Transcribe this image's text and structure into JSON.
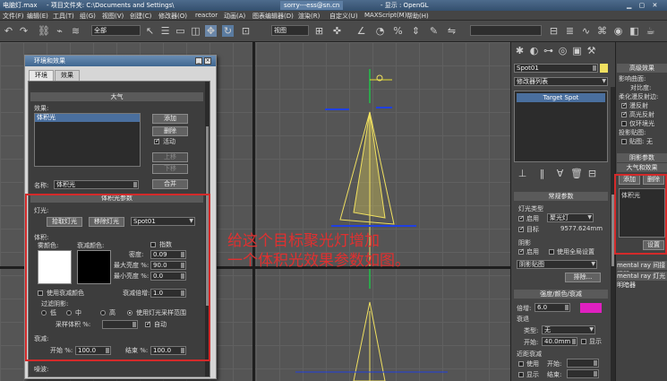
{
  "titlebar": {
    "file": "电脑灯.max",
    "project": "- 项目文件夹: C:\\Documents and Settings\\",
    "tab": "sorry---ess@sn.cn",
    "product": "- 显示 : OpenGL"
  },
  "menu": [
    "文件(F)",
    "编辑(E)",
    "工具(T)",
    "组(G)",
    "视图(V)",
    "创建(C)",
    "修改器(O)",
    "reactor",
    "动画(A)",
    "图表编辑器(D)",
    "渲染(R)",
    "自定义(U)",
    "MAXScript(M)",
    "帮助(H)"
  ],
  "toolbar": {
    "selection_filter": "全部",
    "coord_system": "视图",
    "named_selection": ""
  },
  "dialog": {
    "title": "环境和效果",
    "tabs": [
      "环境",
      "效果"
    ],
    "atmosphere": {
      "rollout": "大气",
      "effects_label": "效果:",
      "effects": [
        "体积光"
      ],
      "add": "添加",
      "delete": "删除",
      "active": "活动",
      "move_up": "上移",
      "move_down": "下移",
      "name_label": "名称:",
      "name_value": "体积光",
      "merge": "合并"
    },
    "volume_light": {
      "rollout": "体积光参数",
      "lights_label": "灯光:",
      "pick_light": "拾取灯光",
      "remove_light": "移除灯光",
      "light_name": "Spot01",
      "volume_label": "体积:",
      "fog_color": "雾颜色:",
      "atten_color": "衰减颜色:",
      "exponential": "指数",
      "density_label": "密度:",
      "density": "0.09",
      "max_brightness_label": "最大亮度 %:",
      "max_brightness": "90.0",
      "min_brightness_label": "最小亮度 %:",
      "min_brightness": "0.0",
      "use_atten_color": "使用衰减颜色",
      "atten_mult_label": "衰减倍增:",
      "atten_mult": "1.0",
      "filter_shadows": "过滤阴影:",
      "low": "低",
      "medium": "中",
      "high": "高",
      "use_light_sample": "使用灯光采样范围",
      "sample_volume_label": "采样体积 %:",
      "auto": "自动",
      "attenuation_label": "衰减:",
      "start_label": "开始 %:",
      "start": "100.0",
      "end_label": "结束 %:",
      "end": "100.0",
      "noise_label": "噪波:"
    }
  },
  "annotation": {
    "line1": "给这个目标聚光灯增加",
    "line2": "一个体积光效果参数如图。"
  },
  "command_panel": {
    "object_name": "Spot01",
    "modifier_list": "修改器列表",
    "stack_item": "Target Spot",
    "general_rollout": "常规参数",
    "light_type_label": "灯光类型",
    "enabled": "启用",
    "light_type": "聚光灯",
    "targeted": "目标",
    "target_dist": "9577.624mm",
    "shadows_label": "阴影",
    "shadows_enabled": "启用",
    "use_global": "使用全局设置",
    "shadow_type": "阴影贴图",
    "exclude": "排除...",
    "intensity_rollout": "强度/颜色/衰减",
    "multiplier_label": "倍增:",
    "multiplier": "6.0",
    "decay_label": "衰退",
    "decay_type_label": "类型:",
    "decay_type": "无",
    "decay_start_label": "开始:",
    "decay_start": "40.0mm",
    "show": "显示",
    "near_atten_label": "近距衰减",
    "use": "使用",
    "start": "开始:",
    "near_show": "显示",
    "end": "结束:",
    "accent": "#e020c0"
  },
  "far_right": {
    "rollout1": "高级效果",
    "affect_surfaces": "影响曲面:",
    "contrast": "对比度:",
    "soften_diff": "柔化漫反射边:",
    "diffuse": "漫反射",
    "specular": "高光反射",
    "ambient_only": "仅环境光",
    "proj_map": "投影贴图:",
    "map": "贴图:",
    "none": "无",
    "shadow_params": "阴影参数",
    "atmos_effects": "大气和效果",
    "add": "添加",
    "delete": "删除",
    "list_item": "体积光",
    "setup": "设置",
    "mental_ray1": "mental ray 间接照明",
    "mental_ray2": "mental ray 灯光明暗器"
  },
  "colors": {
    "highlight": "#d42a2a",
    "annotation": "#e03030",
    "light_yellow": "#f0e060"
  }
}
